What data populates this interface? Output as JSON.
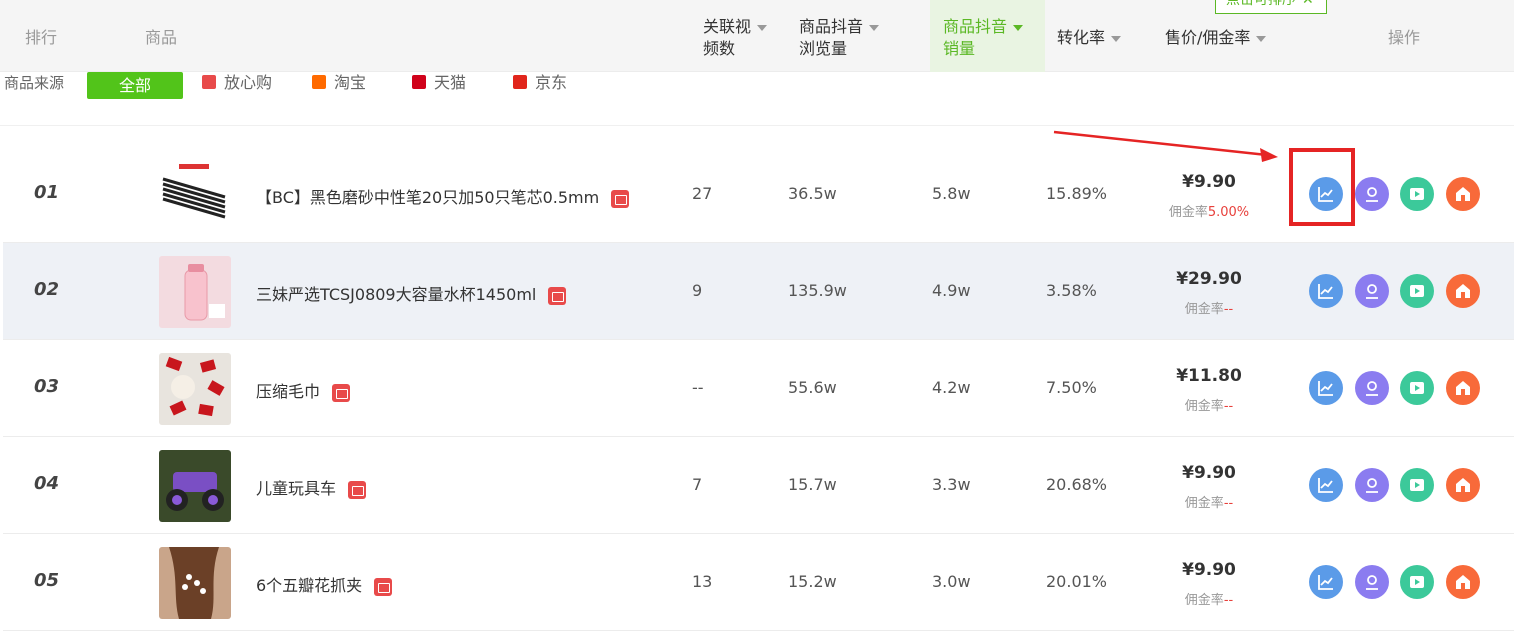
{
  "header": {
    "rank": "排行",
    "product": "商品",
    "related_videos_l1": "关联视",
    "related_videos_l2": "频数",
    "views_l1": "商品抖音",
    "views_l2": "浏览量",
    "sales_l1": "商品抖音",
    "sales_l2": "销量",
    "conversion": "转化率",
    "price": "售价/佣金率",
    "actions": "操作",
    "tooltip": "点击可排序",
    "tooltip_close": "✕"
  },
  "source_filter": {
    "label": "商品来源",
    "options": [
      "全部",
      "放心购",
      "淘宝",
      "天猫",
      "京东"
    ],
    "selected": "全部"
  },
  "commission_label": "佣金率",
  "rows": [
    {
      "rank": "01",
      "name": "【BC】黑色磨砂中性笔20只加50只笔芯0.5mm",
      "videos": "27",
      "views": "36.5w",
      "sales": "5.8w",
      "conversion": "15.89%",
      "price": "¥9.90",
      "commission": "5.00%"
    },
    {
      "rank": "02",
      "name": "三妹严选TCSJ0809大容量水杯1450ml",
      "videos": "9",
      "views": "135.9w",
      "sales": "4.9w",
      "conversion": "3.58%",
      "price": "¥29.90",
      "commission": "--"
    },
    {
      "rank": "03",
      "name": "压缩毛巾",
      "videos": "--",
      "views": "55.6w",
      "sales": "4.2w",
      "conversion": "7.50%",
      "price": "¥11.80",
      "commission": "--"
    },
    {
      "rank": "04",
      "name": "儿童玩具车",
      "videos": "7",
      "views": "15.7w",
      "sales": "3.3w",
      "conversion": "20.68%",
      "price": "¥9.90",
      "commission": "--"
    },
    {
      "rank": "05",
      "name": "6个五瓣花抓夹",
      "videos": "13",
      "views": "15.2w",
      "sales": "3.0w",
      "conversion": "20.01%",
      "price": "¥9.90",
      "commission": "--"
    }
  ],
  "icons": {
    "shop": "shop-bag-icon",
    "trend": "trend-chart-icon",
    "user": "user-icon",
    "video": "video-play-icon",
    "store": "store-icon"
  },
  "colors": {
    "accent_green": "#52c41a",
    "commission_red": "#e8413c",
    "annotation_red": "#e52424"
  }
}
